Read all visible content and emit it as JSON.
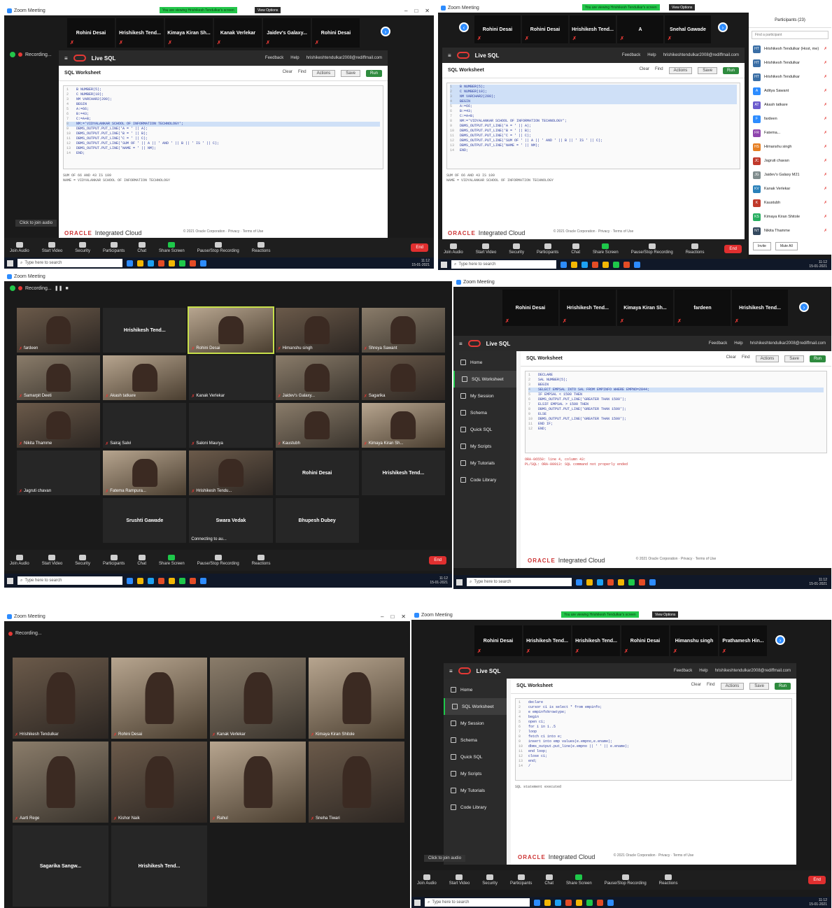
{
  "window_title": "Zoom Meeting",
  "green_bar": "You are viewing Hrishikesh Tendulkar's screen",
  "view_options": "View Options",
  "recording": "Recording...",
  "live_sql": "Live SQL",
  "sql_worksheet": "SQL Worksheet",
  "feedback": "Feedback",
  "help": "Help",
  "user_email": "hrishikeshtendulkar2008@rediffmail.com",
  "ws_clear": "Clear",
  "ws_find": "Find",
  "ws_actions": "Actions",
  "ws_save": "Save",
  "ws_run": "Run",
  "oracle": "ORACLE",
  "integrated_cloud": "Integrated Cloud",
  "copyright": "© 2021 Oracle Corporation · Privacy · Terms of Use",
  "click_to_join_audio": "Click to join audio",
  "nav": [
    "Home",
    "SQL Worksheet",
    "My Session",
    "Schema",
    "Quick SQL",
    "My Scripts",
    "My Tutorials",
    "Code Library"
  ],
  "toolbar": {
    "join_audio": "Join Audio",
    "start_video": "Start Video",
    "security": "Security",
    "participants": "Participants",
    "participants_count": "23",
    "chat": "Chat",
    "chat_badge": "59",
    "share_screen": "Share Screen",
    "record": "Pause/Stop Recording",
    "reactions": "Reactions",
    "end": "End"
  },
  "taskbar_search": "Type here to search",
  "time": "11:12",
  "date": "15-01-2021",
  "shot1": {
    "strip": [
      "Rohini Desai",
      "Hrishikesh Tend...",
      "Kimaya Kiran Sh...",
      "Kanak Verlekar",
      "Jaidev's Galaxy...",
      "Rohini Desai"
    ],
    "code": [
      "B NUMBER(5);",
      "C NUMBER(10);",
      "NM VARCHAR2(200);",
      "BEGIN",
      "A:=66;",
      "B:=43;",
      "C:=A+B;",
      "NM:='VIDYALANKAR SCHOOL OF INFORMATION TECHNOLOGY';",
      "DBMS_OUTPUT.PUT_LINE('A = ' || A);",
      "DBMS_OUTPUT.PUT_LINE('B = ' || B);",
      "DBMS_OUTPUT.PUT_LINE('C = ' || C);",
      "DBMS_OUTPUT.PUT_LINE('SUM OF ' || A || ' AND ' || B || ' IS ' || C);",
      "DBMS_OUTPUT.PUT_LINE('NAME = ' || NM);",
      "END;"
    ],
    "output": [
      "SUM OF 66 AND 43 IS 109",
      "NAME = VIDYALANKAR SCHOOL OF INFORMATION TECHNOLOGY"
    ]
  },
  "shot2": {
    "strip": [
      "Rohini Desai",
      "Rohini Desai",
      "Hrishikesh Tend...",
      "A",
      "Snehal Gawade"
    ],
    "participants_title": "Participants (23)",
    "participants_search": "Find a participant",
    "participants": [
      {
        "initials": "HT",
        "name": "Hrishikesh Tendulkar (Host, me)",
        "color": "#3a6ea5"
      },
      {
        "initials": "HT",
        "name": "Hrishikesh Tendulkar",
        "color": "#3a6ea5"
      },
      {
        "initials": "HT",
        "name": "Hrishikesh Tendulkar",
        "color": "#3a6ea5"
      },
      {
        "initials": "A",
        "name": "Aditya Sawant",
        "color": "#2d8cff"
      },
      {
        "initials": "AT",
        "name": "Akash tatkare",
        "color": "#6a5acd"
      },
      {
        "initials": "F",
        "name": "fardeen",
        "color": "#2d8cff"
      },
      {
        "initials": "FR",
        "name": "Fatema...",
        "color": "#8e44ad"
      },
      {
        "initials": "HS",
        "name": "Himanshu singh",
        "color": "#e67e22"
      },
      {
        "initials": "JC",
        "name": "Jagruti chavan",
        "color": "#c0392b"
      },
      {
        "initials": "JG",
        "name": "Jaidev's Galaxy M21",
        "color": "#7f8c8d"
      },
      {
        "initials": "KV",
        "name": "Kanak Verlekar",
        "color": "#2980b9"
      },
      {
        "initials": "K",
        "name": "Kaustubh",
        "color": "#c0392b"
      },
      {
        "initials": "KS",
        "name": "Kimaya Kiran Shitole",
        "color": "#27ae60"
      },
      {
        "initials": "NT",
        "name": "Nikita Thamme",
        "color": "#34495e"
      }
    ],
    "admit": "Admit to Waiting Room",
    "more": "More",
    "invite": "Invite",
    "mute_all": "Mute All"
  },
  "shot3": {
    "tiles": [
      {
        "name": "fardeen",
        "type": "photo",
        "active": false
      },
      {
        "name": "Hrishikesh Tend...",
        "type": "name",
        "active": false
      },
      {
        "name": "Rohini Desai",
        "type": "photo3",
        "active": true
      },
      {
        "name": "Himanshu singh",
        "type": "photo",
        "active": false
      },
      {
        "name": "Shreya Sawant",
        "type": "photo2",
        "active": false
      },
      {
        "name": "Samarpit Deeti",
        "type": "photo2",
        "active": false
      },
      {
        "name": "Akash tatkare",
        "type": "photo3",
        "active": false
      },
      {
        "name": "Kanak Verlekar",
        "type": "blank",
        "active": false
      },
      {
        "name": "Jaidev's Galaxy...",
        "type": "photo2",
        "active": false
      },
      {
        "name": "Sagarika",
        "type": "photo",
        "active": false
      },
      {
        "name": "Nikita Thamme",
        "type": "photo",
        "active": false
      },
      {
        "name": "Sairaj Salvi",
        "type": "blank",
        "active": false
      },
      {
        "name": "Saloni Maurya",
        "type": "blank",
        "active": false
      },
      {
        "name": "Kaustubh",
        "type": "photo2",
        "active": false
      },
      {
        "name": "Kimaya Kiran Sh...",
        "type": "photo3",
        "active": false
      },
      {
        "name": "Jagruti chavan",
        "type": "blank",
        "active": false
      },
      {
        "name": "Fatema Rampura...",
        "type": "photo3",
        "active": false
      },
      {
        "name": "Hrishikesh Tendu...",
        "type": "photo",
        "active": false
      },
      {
        "name": "Rohini Desai",
        "type": "name",
        "active": false
      },
      {
        "name": "Hrishikesh Tend...",
        "type": "name",
        "active": false
      },
      {
        "name": "",
        "type": "empty",
        "active": false
      },
      {
        "name": "Srushti Gawade",
        "type": "name",
        "active": false
      },
      {
        "name": "Swara Vedak",
        "type": "name",
        "active": false
      },
      {
        "name": "Bhupesh Dubey",
        "type": "name",
        "active": false
      },
      {
        "name": "",
        "type": "empty",
        "active": false
      }
    ],
    "connecting": "Connecting to au..."
  },
  "shot4": {
    "strip": [
      "Rohini Desai",
      "Hrishikesh Tend...",
      "Kimaya Kiran Sh...",
      "fardeen",
      "Hrishikesh Tend..."
    ],
    "code": [
      "DECLARE",
      "SAL NUMBER(5);",
      "BEGIN",
      "SELECT EMPSAL INTO SAL FROM EMPINFO WHERE EMPNO=2044;",
      "IF EMPSAL < 1500 THEN",
      "DBMS_OUTPUT.PUT_LINE('GREATER THAN 1500');",
      "ELSIF EMPSAL > 1500 THEN",
      "DBMS_OUTPUT.PUT_LINE('GREATER THAN 1500');",
      "ELSE",
      "DBMS_OUTPUT.PUT_LINE('GREATER THAN 1500');",
      "END IF;",
      "END;"
    ],
    "output": [
      "ORA-06550: line 4, column 43:",
      "PL/SQL: ORA-00913: SQL command not properly ended"
    ]
  },
  "shot5": {
    "tiles": [
      {
        "name": "Hrishikesh Tendulkar",
        "type": "photo"
      },
      {
        "name": "Rohini Desai",
        "type": "photo3"
      },
      {
        "name": "Kanak Verlekar",
        "type": "photo2"
      },
      {
        "name": "Kimaya Kiran Shitole",
        "type": "photo3"
      },
      {
        "name": "Aarti Rege",
        "type": "photo2"
      },
      {
        "name": "Kishor Naik",
        "type": "photo"
      },
      {
        "name": "Rahul",
        "type": "photo3"
      },
      {
        "name": "Sneha Tiwari",
        "type": "photo"
      },
      {
        "name": "Sagarika Sangw...",
        "type": "name"
      },
      {
        "name": "Hrishikesh Tend...",
        "type": "name"
      }
    ]
  },
  "shot6": {
    "strip": [
      "Rohini Desai",
      "Hrishikesh Tend...",
      "Hrishikesh Tend...",
      "Rohini Desai",
      "Himanshu singh",
      "Prathamesh Hin..."
    ],
    "code": [
      "declare",
      "cursor c1 is select * from empinfo;",
      "e empinfo%rowtype;",
      "begin",
      "open c1;",
      "for i in 1..5",
      "loop",
      "fetch c1 into e;",
      "insert into emp values(e.empno,e.ename);",
      "dbms_output.put_line(e.empno || ' ' || e.ename);",
      "end loop;",
      "close c1;",
      "end;",
      "/"
    ],
    "output": [
      "SQL statement executed"
    ]
  }
}
